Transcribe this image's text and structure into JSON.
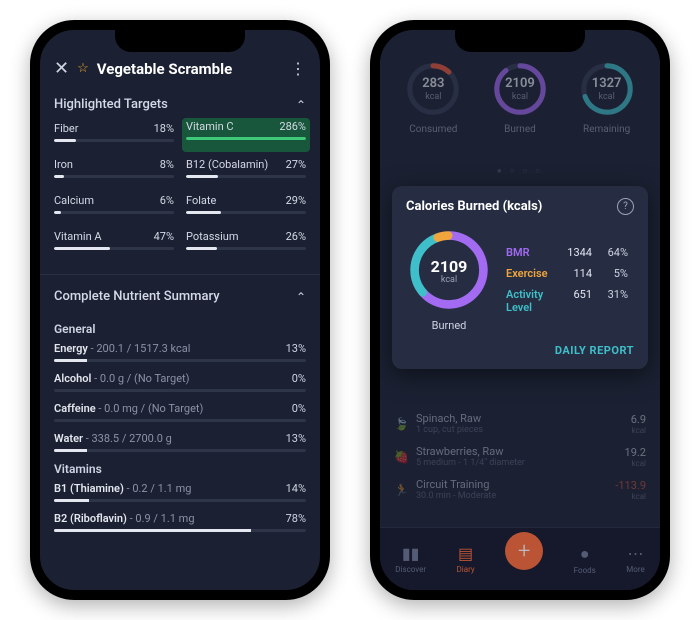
{
  "phone1": {
    "title": "Vegetable Scramble",
    "highlighted_header": "Highlighted Targets",
    "targets_left": [
      {
        "name": "Fiber",
        "pct_label": "18%",
        "pct": 18
      },
      {
        "name": "Iron",
        "pct_label": "8%",
        "pct": 8
      },
      {
        "name": "Calcium",
        "pct_label": "6%",
        "pct": 6
      },
      {
        "name": "Vitamin A",
        "pct_label": "47%",
        "pct": 47
      }
    ],
    "targets_right": [
      {
        "name": "Vitamin C",
        "pct_label": "286%",
        "pct": 100,
        "is_vc": true
      },
      {
        "name": "B12 (Cobalamin)",
        "pct_label": "27%",
        "pct": 27
      },
      {
        "name": "Folate",
        "pct_label": "29%",
        "pct": 29
      },
      {
        "name": "Potassium",
        "pct_label": "26%",
        "pct": 26
      }
    ],
    "summary_header": "Complete Nutrient Summary",
    "group_general": "General",
    "general": [
      {
        "name": "Energy",
        "val": " - 200.1 / 1517.3 kcal",
        "pct_label": "13%",
        "pct": 13
      },
      {
        "name": "Alcohol",
        "val": " - 0.0 g / (No Target)",
        "pct_label": "0%",
        "pct": 0
      },
      {
        "name": "Caffeine",
        "val": " - 0.0 mg / (No Target)",
        "pct_label": "0%",
        "pct": 0
      },
      {
        "name": "Water",
        "val": " - 338.5 / 2700.0 g",
        "pct_label": "13%",
        "pct": 13
      }
    ],
    "group_vitamins": "Vitamins",
    "vitamins": [
      {
        "name": "B1 (Thiamine)",
        "val": " - 0.2 / 1.1 mg",
        "pct_label": "14%",
        "pct": 14
      },
      {
        "name": "B2 (Riboflavin)",
        "val": " - 0.9 / 1.1 mg",
        "pct_label": "78%",
        "pct": 78
      }
    ]
  },
  "phone2": {
    "rings": [
      {
        "num": "283",
        "unit": "kcal",
        "label": "Consumed",
        "color": "#f05a3c",
        "pct": 12
      },
      {
        "num": "2109",
        "unit": "kcal",
        "label": "Burned",
        "color": "#a26bf2",
        "pct": 90
      },
      {
        "num": "1327",
        "unit": "kcal",
        "label": "Remaining",
        "color": "#3fbfc9",
        "pct": 70
      }
    ],
    "card_title": "Calories Burned (kcals)",
    "big_ring": {
      "num": "2109",
      "unit": "kcal",
      "label": "Burned"
    },
    "legend": [
      {
        "cls": "bmr",
        "name": "BMR",
        "value": "1344",
        "pct": "64%"
      },
      {
        "cls": "ex",
        "name": "Exercise",
        "value": "114",
        "pct": "5%"
      },
      {
        "cls": "act",
        "name": "Activity Level",
        "value": "651",
        "pct": "31%"
      }
    ],
    "daily_report": "DAILY REPORT",
    "bg_items": [
      {
        "icon": "🍃",
        "color": "#3fc97b",
        "line1": "Spinach, Raw",
        "line2": "1 cup, cut pieces",
        "cal": "6.9",
        "unit": "kcal"
      },
      {
        "icon": "🍓",
        "color": "#e04a5a",
        "line1": "Strawberries, Raw",
        "line2": "5 medium - 1 1/4\" diameter",
        "cal": "19.2",
        "unit": "kcal"
      },
      {
        "icon": "🏃",
        "color": "#3fbfc9",
        "line1": "Circuit Training",
        "line2": "30.0 min - Moderate",
        "cal": "-113.9",
        "unit": "kcal",
        "neg": true
      }
    ],
    "tabs": {
      "discover": "Discover",
      "diary": "Diary",
      "foods": "Foods",
      "more": "More"
    }
  }
}
